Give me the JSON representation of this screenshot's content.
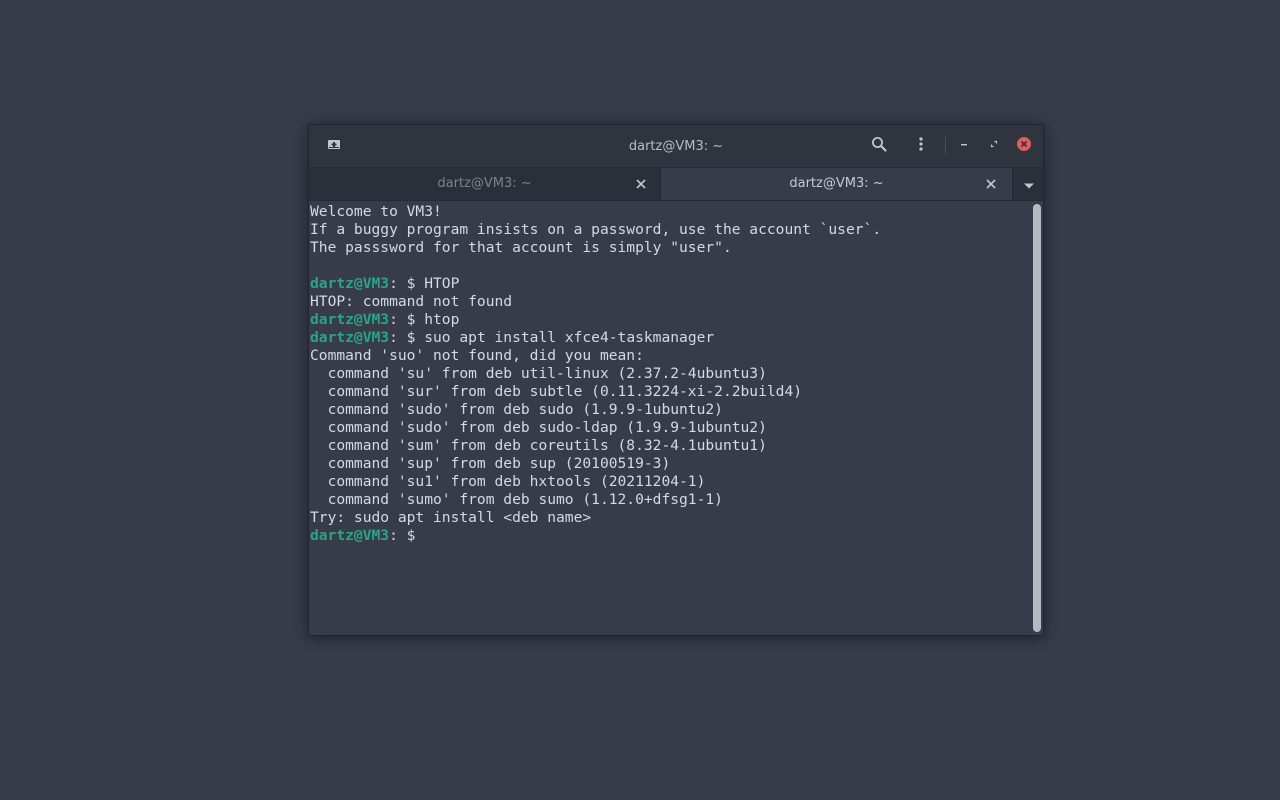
{
  "window": {
    "title": "dartz@VM3: ~"
  },
  "headerbar": {
    "new_tab_icon": "new-tab-icon",
    "search_icon": "search-icon",
    "menu_icon": "vertical-dots-menu-icon",
    "minimize_icon": "minimize-icon",
    "maximize_icon": "maximize-icon",
    "close_icon": "close-icon"
  },
  "tabs": [
    {
      "label": "dartz@VM3: ~",
      "active": false
    },
    {
      "label": "dartz@VM3: ~",
      "active": true
    }
  ],
  "terminal": {
    "lines": [
      {
        "prompt": "",
        "sep": "",
        "text": "Welcome to VM3!"
      },
      {
        "prompt": "",
        "sep": "",
        "text": "If a buggy program insists on a password, use the account `user`."
      },
      {
        "prompt": "",
        "sep": "",
        "text": "The passsword for that account is simply \"user\"."
      },
      {
        "prompt": "",
        "sep": "",
        "text": ""
      },
      {
        "prompt": "dartz@VM3",
        "sep": ": $ ",
        "text": "HTOP"
      },
      {
        "prompt": "",
        "sep": "",
        "text": "HTOP: command not found"
      },
      {
        "prompt": "dartz@VM3",
        "sep": ": $ ",
        "text": "htop"
      },
      {
        "prompt": "dartz@VM3",
        "sep": ": $ ",
        "text": "suo apt install xfce4-taskmanager"
      },
      {
        "prompt": "",
        "sep": "",
        "text": "Command 'suo' not found, did you mean:"
      },
      {
        "prompt": "",
        "sep": "",
        "text": "  command 'su' from deb util-linux (2.37.2-4ubuntu3)"
      },
      {
        "prompt": "",
        "sep": "",
        "text": "  command 'sur' from deb subtle (0.11.3224-xi-2.2build4)"
      },
      {
        "prompt": "",
        "sep": "",
        "text": "  command 'sudo' from deb sudo (1.9.9-1ubuntu2)"
      },
      {
        "prompt": "",
        "sep": "",
        "text": "  command 'sudo' from deb sudo-ldap (1.9.9-1ubuntu2)"
      },
      {
        "prompt": "",
        "sep": "",
        "text": "  command 'sum' from deb coreutils (8.32-4.1ubuntu1)"
      },
      {
        "prompt": "",
        "sep": "",
        "text": "  command 'sup' from deb sup (20100519-3)"
      },
      {
        "prompt": "",
        "sep": "",
        "text": "  command 'su1' from deb hxtools (20211204-1)"
      },
      {
        "prompt": "",
        "sep": "",
        "text": "  command 'sumo' from deb sumo (1.12.0+dfsg1-1)"
      },
      {
        "prompt": "",
        "sep": "",
        "text": "Try: sudo apt install <deb name>"
      },
      {
        "prompt": "dartz@VM3",
        "sep": ": $ ",
        "text": ""
      }
    ]
  },
  "colors": {
    "desktop_bg": "#373c4a",
    "terminal_bg": "#383c4a",
    "terminal_fg": "#d3dae3",
    "prompt_green": "#27a683",
    "close_button_red": "#e05c5c"
  }
}
